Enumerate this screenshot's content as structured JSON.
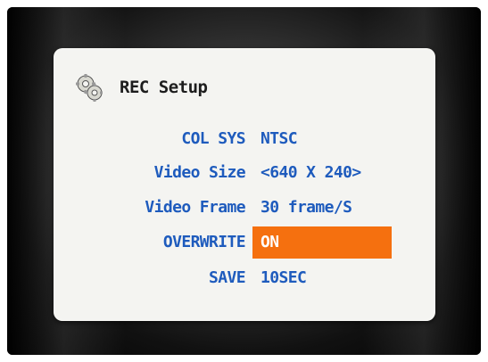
{
  "menu": {
    "title": "REC Setup",
    "title_icon": "gear-icon",
    "items": [
      {
        "label": "COL SYS",
        "value": "NTSC"
      },
      {
        "label": "Video Size",
        "value": "<640 X 240>"
      },
      {
        "label": "Video Frame",
        "value": "30 frame/S"
      },
      {
        "label": "OVERWRITE",
        "value": "ON",
        "selected": true
      },
      {
        "label": "SAVE",
        "value": "10SEC"
      }
    ]
  },
  "colors": {
    "label_text": "#1e5bbd",
    "highlight": "#f5700f",
    "panel_bg": "#f4f4f1"
  }
}
